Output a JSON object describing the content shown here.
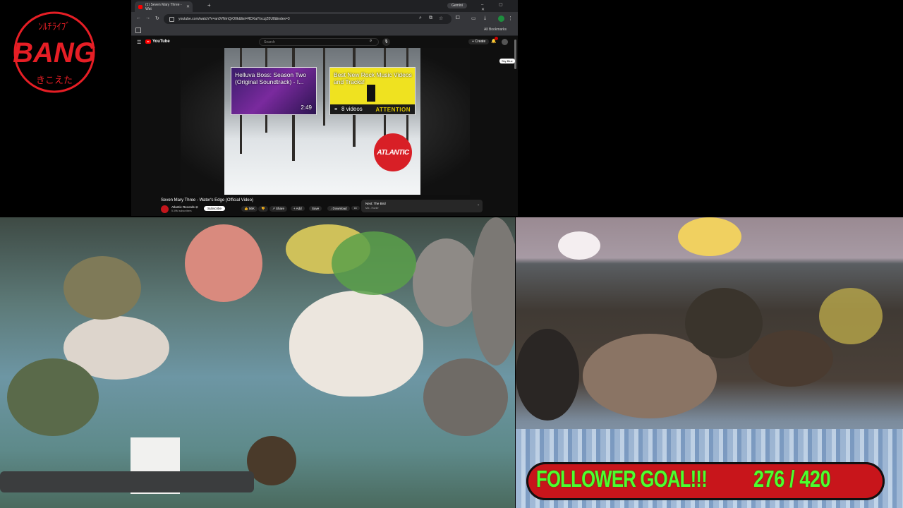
{
  "logo": {
    "text": "BANG",
    "top_text": "ﾝﾙﾁﾗｲﾌﾞ",
    "bottom_text": "きこえた",
    "color": "#e61e25"
  },
  "browser": {
    "tab_title": "(1) Seven Mary Three - Wat",
    "new_tab_glyph": "+",
    "gemini_label": "Gemini",
    "window_controls": "– ▢ ✕",
    "url": "youtube.com/watch?v=an0VNmQrO0k&list=RDXaIYxczjZ0U8&index=3",
    "all_bookmarks": "All Bookmarks"
  },
  "youtube": {
    "logo_text": "YouTube",
    "search_placeholder": "Search",
    "create_label": "+ Create",
    "small_button": "Sky Blue",
    "video_title": "Seven Mary Three - Water's Edge (Official Video)",
    "channel_name": "Atlantic Records ⊘",
    "channel_subs": "5.39M subscribers",
    "subscribe_label": "Subscribe",
    "like_count": "👍 56K",
    "dislike": "👎",
    "share": "↗ Share",
    "add": "+ Add",
    "save": "Save",
    "download": "↓ Download",
    "more": "•••",
    "next_label": "Next: The Bird",
    "next_sub": "Mix - Hozier",
    "card1": {
      "title": "Helluva Boss: Season Two (Original Soundtrack) - I...",
      "duration": "2:49"
    },
    "card2": {
      "title": "Best New Rock Music Videos and Tracks!",
      "count": "8 videos",
      "banner": "ATTENTION"
    },
    "atlantic_logo": "ATLANTIC"
  },
  "goal": {
    "label": "FOLLOWER GOAL!!!",
    "count_text": "276 / 420",
    "current": 276,
    "target": 420,
    "bg_color": "#c8151b",
    "text_color": "#4dff2e"
  }
}
